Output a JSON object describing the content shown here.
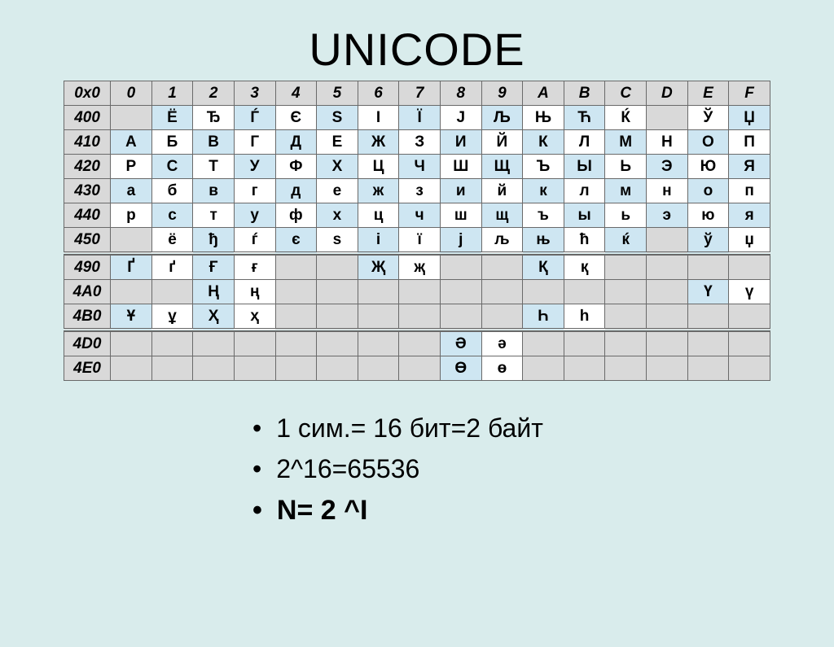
{
  "title": "UNICODE",
  "chart_data": {
    "type": "table",
    "corner": "0x0",
    "columns": [
      "0",
      "1",
      "2",
      "3",
      "4",
      "5",
      "6",
      "7",
      "8",
      "9",
      "A",
      "B",
      "C",
      "D",
      "E",
      "F"
    ],
    "groups": [
      {
        "rows": [
          {
            "head": "400",
            "cells": [
              {
                "v": ""
              },
              {
                "v": "Ё",
                "a": true
              },
              {
                "v": "Ђ"
              },
              {
                "v": "Ѓ",
                "a": true
              },
              {
                "v": "Є"
              },
              {
                "v": "Ѕ",
                "a": true
              },
              {
                "v": "І"
              },
              {
                "v": "Ї",
                "a": true
              },
              {
                "v": "Ј"
              },
              {
                "v": "Љ",
                "a": true
              },
              {
                "v": "Њ"
              },
              {
                "v": "Ћ",
                "a": true
              },
              {
                "v": "Ќ"
              },
              {
                "v": "",
                "a": true
              },
              {
                "v": "Ў"
              },
              {
                "v": "Џ",
                "a": true
              }
            ]
          },
          {
            "head": "410",
            "cells": [
              {
                "v": "А",
                "a": true
              },
              {
                "v": "Б"
              },
              {
                "v": "В",
                "a": true
              },
              {
                "v": "Г"
              },
              {
                "v": "Д",
                "a": true
              },
              {
                "v": "Е"
              },
              {
                "v": "Ж",
                "a": true
              },
              {
                "v": "З"
              },
              {
                "v": "И",
                "a": true
              },
              {
                "v": "Й"
              },
              {
                "v": "К",
                "a": true
              },
              {
                "v": "Л"
              },
              {
                "v": "М",
                "a": true
              },
              {
                "v": "Н"
              },
              {
                "v": "О",
                "a": true
              },
              {
                "v": "П"
              }
            ]
          },
          {
            "head": "420",
            "cells": [
              {
                "v": "Р"
              },
              {
                "v": "С",
                "a": true
              },
              {
                "v": "Т"
              },
              {
                "v": "У",
                "a": true
              },
              {
                "v": "Ф"
              },
              {
                "v": "Х",
                "a": true
              },
              {
                "v": "Ц"
              },
              {
                "v": "Ч",
                "a": true
              },
              {
                "v": "Ш"
              },
              {
                "v": "Щ",
                "a": true
              },
              {
                "v": "Ъ"
              },
              {
                "v": "Ы",
                "a": true
              },
              {
                "v": "Ь"
              },
              {
                "v": "Э",
                "a": true
              },
              {
                "v": "Ю"
              },
              {
                "v": "Я",
                "a": true
              }
            ]
          },
          {
            "head": "430",
            "cells": [
              {
                "v": "а",
                "a": true
              },
              {
                "v": "б"
              },
              {
                "v": "в",
                "a": true
              },
              {
                "v": "г"
              },
              {
                "v": "д",
                "a": true
              },
              {
                "v": "е"
              },
              {
                "v": "ж",
                "a": true
              },
              {
                "v": "з"
              },
              {
                "v": "и",
                "a": true
              },
              {
                "v": "й"
              },
              {
                "v": "к",
                "a": true
              },
              {
                "v": "л"
              },
              {
                "v": "м",
                "a": true
              },
              {
                "v": "н"
              },
              {
                "v": "о",
                "a": true
              },
              {
                "v": "п"
              }
            ]
          },
          {
            "head": "440",
            "cells": [
              {
                "v": "р"
              },
              {
                "v": "с",
                "a": true
              },
              {
                "v": "т"
              },
              {
                "v": "у",
                "a": true
              },
              {
                "v": "ф"
              },
              {
                "v": "х",
                "a": true
              },
              {
                "v": "ц"
              },
              {
                "v": "ч",
                "a": true
              },
              {
                "v": "ш"
              },
              {
                "v": "щ",
                "a": true
              },
              {
                "v": "ъ"
              },
              {
                "v": "ы",
                "a": true
              },
              {
                "v": "ь"
              },
              {
                "v": "э",
                "a": true
              },
              {
                "v": "ю"
              },
              {
                "v": "я",
                "a": true
              }
            ]
          },
          {
            "head": "450",
            "cells": [
              {
                "v": "",
                "a": true
              },
              {
                "v": "ё"
              },
              {
                "v": "ђ",
                "a": true
              },
              {
                "v": "ѓ"
              },
              {
                "v": "є",
                "a": true
              },
              {
                "v": "ѕ"
              },
              {
                "v": "і",
                "a": true
              },
              {
                "v": "ї"
              },
              {
                "v": "ј",
                "a": true
              },
              {
                "v": "љ"
              },
              {
                "v": "њ",
                "a": true
              },
              {
                "v": "ћ"
              },
              {
                "v": "ќ",
                "a": true
              },
              {
                "v": ""
              },
              {
                "v": "ў",
                "a": true
              },
              {
                "v": "џ"
              }
            ]
          }
        ]
      },
      {
        "rows": [
          {
            "head": "490",
            "cells": [
              {
                "v": "Ґ",
                "a": true
              },
              {
                "v": "ґ"
              },
              {
                "v": "Ғ",
                "a": true
              },
              {
                "v": "ғ"
              },
              {
                "v": ""
              },
              {
                "v": ""
              },
              {
                "v": "Җ",
                "a": true
              },
              {
                "v": "җ"
              },
              {
                "v": ""
              },
              {
                "v": ""
              },
              {
                "v": "Қ",
                "a": true
              },
              {
                "v": "қ"
              },
              {
                "v": ""
              },
              {
                "v": ""
              },
              {
                "v": ""
              },
              {
                "v": ""
              }
            ]
          },
          {
            "head": "4A0",
            "cells": [
              {
                "v": ""
              },
              {
                "v": ""
              },
              {
                "v": "Ң",
                "a": true
              },
              {
                "v": "ң"
              },
              {
                "v": ""
              },
              {
                "v": ""
              },
              {
                "v": ""
              },
              {
                "v": ""
              },
              {
                "v": ""
              },
              {
                "v": ""
              },
              {
                "v": ""
              },
              {
                "v": ""
              },
              {
                "v": ""
              },
              {
                "v": ""
              },
              {
                "v": "Ү",
                "a": true
              },
              {
                "v": "ү"
              }
            ]
          },
          {
            "head": "4B0",
            "cells": [
              {
                "v": "Ұ",
                "a": true
              },
              {
                "v": "ұ"
              },
              {
                "v": "Ҳ",
                "a": true
              },
              {
                "v": "ҳ"
              },
              {
                "v": ""
              },
              {
                "v": ""
              },
              {
                "v": ""
              },
              {
                "v": ""
              },
              {
                "v": ""
              },
              {
                "v": ""
              },
              {
                "v": "Һ",
                "a": true
              },
              {
                "v": "һ"
              },
              {
                "v": ""
              },
              {
                "v": ""
              },
              {
                "v": ""
              },
              {
                "v": ""
              }
            ]
          }
        ]
      },
      {
        "rows": [
          {
            "head": "4D0",
            "cells": [
              {
                "v": ""
              },
              {
                "v": ""
              },
              {
                "v": ""
              },
              {
                "v": ""
              },
              {
                "v": ""
              },
              {
                "v": ""
              },
              {
                "v": ""
              },
              {
                "v": ""
              },
              {
                "v": "Ә",
                "a": true
              },
              {
                "v": "ә"
              },
              {
                "v": ""
              },
              {
                "v": ""
              },
              {
                "v": ""
              },
              {
                "v": ""
              },
              {
                "v": ""
              },
              {
                "v": ""
              }
            ]
          },
          {
            "head": "4E0",
            "cells": [
              {
                "v": ""
              },
              {
                "v": ""
              },
              {
                "v": ""
              },
              {
                "v": ""
              },
              {
                "v": ""
              },
              {
                "v": ""
              },
              {
                "v": ""
              },
              {
                "v": ""
              },
              {
                "v": "Ө",
                "a": true
              },
              {
                "v": "ө"
              },
              {
                "v": ""
              },
              {
                "v": ""
              },
              {
                "v": ""
              },
              {
                "v": ""
              },
              {
                "v": ""
              },
              {
                "v": ""
              }
            ]
          }
        ]
      }
    ]
  },
  "bullets": [
    {
      "text": "1 сим.= 16 бит=2 байт",
      "bold": false
    },
    {
      "text": "2^16=65536",
      "bold": false
    },
    {
      "text": "N= 2 ^I",
      "bold": true
    }
  ]
}
